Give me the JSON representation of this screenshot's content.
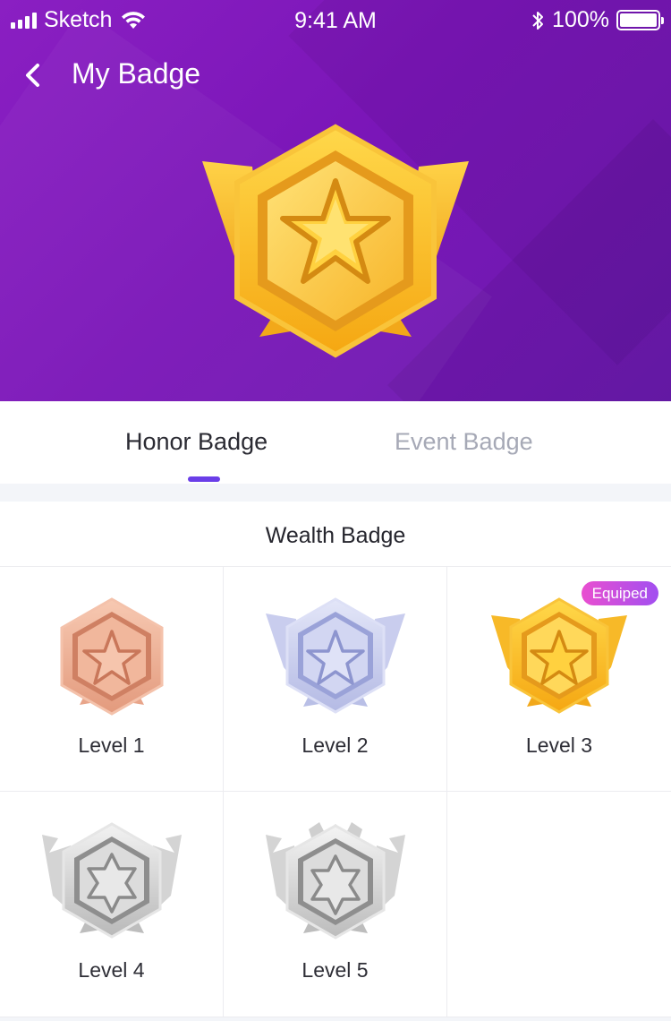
{
  "status_bar": {
    "carrier": "Sketch",
    "time": "9:41 AM",
    "battery": "100%"
  },
  "nav": {
    "title": "My Badge"
  },
  "tabs": [
    {
      "label": "Honor Badge",
      "active": true
    },
    {
      "label": "Event Badge",
      "active": false
    }
  ],
  "section": {
    "title": "Wealth Badge"
  },
  "badges": [
    {
      "label": "Level 1",
      "tier": "bronze"
    },
    {
      "label": "Level 2",
      "tier": "silver-blue"
    },
    {
      "label": "Level 3",
      "tier": "gold",
      "status": "Equiped"
    },
    {
      "label": "Level 4",
      "tier": "silver"
    },
    {
      "label": "Level 5",
      "tier": "silver-crown"
    }
  ],
  "colors": {
    "header": "#7b16b8",
    "accent": "#6a3ee8",
    "equipped_from": "#e94fd0",
    "equipped_to": "#a24ff0"
  }
}
